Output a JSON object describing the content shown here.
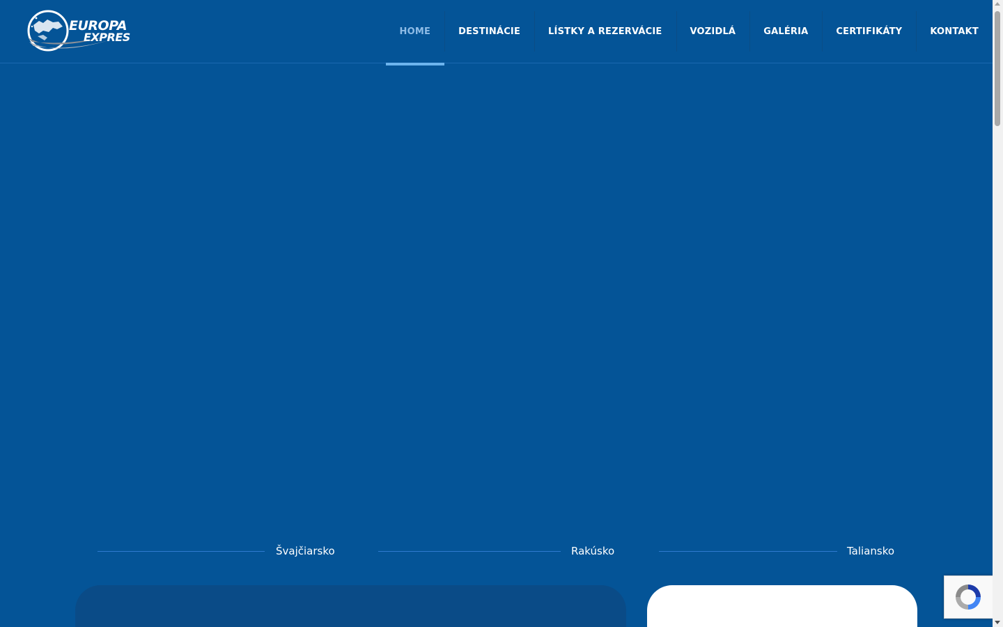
{
  "header": {
    "logo": {
      "line1": "EUROPA",
      "line2": "EXPRES",
      "icon": "globe-swoosh-logo"
    },
    "nav": [
      {
        "label": "HOME",
        "active": true
      },
      {
        "label": "DESTINÁCIE",
        "active": false
      },
      {
        "label": "LÍSTKY A REZERVÁCIE",
        "active": false
      },
      {
        "label": "VOZIDLÁ",
        "active": false
      },
      {
        "label": "GALÉRIA",
        "active": false
      },
      {
        "label": "CERTIFIKÁTY",
        "active": false
      },
      {
        "label": "KONTAKT",
        "active": false
      }
    ]
  },
  "destinations": [
    {
      "label": "Švajčiarsko"
    },
    {
      "label": "Rakúsko"
    },
    {
      "label": "Taliansko"
    }
  ],
  "recaptcha": {
    "icon": "recaptcha-icon"
  },
  "colors": {
    "background": "#045497",
    "nav_active": "#8fbce6",
    "nav_active_underline": "#6cb4ee",
    "card_dark": "#0a4b87",
    "card_light": "#ffffff"
  }
}
